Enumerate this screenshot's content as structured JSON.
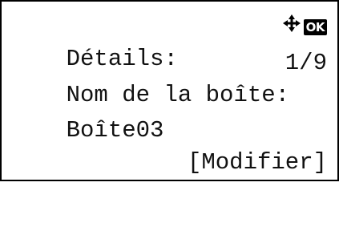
{
  "screen": {
    "title": "Détails:",
    "field_label": "Nom de la boîte:",
    "page_indicator": "1/9",
    "field_value": "Boîte03",
    "softkey_label": "[Modifier]",
    "ok_key_label": "OK",
    "icons": {
      "nav": "four-way-arrow-icon",
      "ok": "ok-key-icon"
    }
  }
}
